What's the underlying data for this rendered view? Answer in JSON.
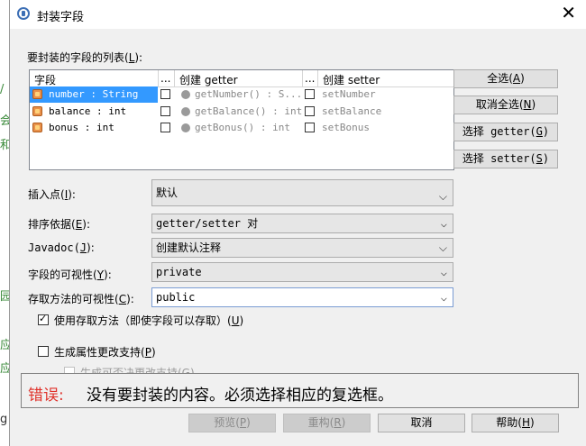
{
  "background": {
    "chars": [
      "/",
      "会",
      "和",
      "园",
      "应",
      "应",
      "g"
    ]
  },
  "titlebar": {
    "title": "封装字段",
    "close_glyph": "✕"
  },
  "fields_list": {
    "label": "要封装的字段的列表(",
    "label_key": "L",
    "label_end": "):",
    "columns": [
      "字段",
      "...",
      "创建 getter",
      "...",
      "创建 setter"
    ],
    "rows": [
      {
        "field": "number : String",
        "getter": "getNumber() : S...",
        "setter": "setNumber",
        "selected": true
      },
      {
        "field": "balance : int",
        "getter": "getBalance() : int",
        "setter": "setBalance",
        "selected": false
      },
      {
        "field": "bonus : int",
        "getter": "getBonus() : int",
        "setter": "setBonus",
        "selected": false
      }
    ]
  },
  "side_buttons": [
    {
      "label": "全选(",
      "key": "A",
      "end": ")"
    },
    {
      "label": "取消全选(",
      "key": "N",
      "end": ")"
    },
    {
      "label": "选择 getter(",
      "key": "G",
      "end": ")"
    },
    {
      "label": "选择 setter(",
      "key": "S",
      "end": ")"
    }
  ],
  "options": {
    "insert_point": {
      "label": "插入点(",
      "key": "I",
      "end": "):",
      "value": "默认"
    },
    "sort_by": {
      "label": "排序依据(",
      "key": "E",
      "end": "):",
      "value": "getter/setter 对"
    },
    "javadoc": {
      "label": "Javadoc(",
      "key": "J",
      "end": "):",
      "value": "创建默认注释"
    },
    "field_visibility": {
      "label": "字段的可视性(",
      "key": "Y",
      "end": "):",
      "value": "private"
    },
    "accessor_visibility": {
      "label": "存取方法的可视性(",
      "key": "C",
      "end": "):",
      "value": "public"
    }
  },
  "checkboxes": {
    "use_accessors": {
      "label": "使用存取方法（即使字段可以存取）(",
      "key": "U",
      "end": ")",
      "checked": true
    },
    "property_change": {
      "label": "生成属性更改支持(",
      "key": "P",
      "end": ")",
      "checked": false
    },
    "veto_change": {
      "label": "生成可否决更改支持(G)",
      "checked": false
    }
  },
  "error": {
    "label": "错误:",
    "message": "没有要封装的内容。必须选择相应的复选框。"
  },
  "footer_buttons": [
    {
      "label": "预览(",
      "key": "P",
      "end": ")",
      "enabled": false
    },
    {
      "label": "重构(",
      "key": "R",
      "end": ")",
      "enabled": false
    },
    {
      "label": "取消",
      "key": "",
      "end": "",
      "enabled": true
    },
    {
      "label": "帮助(",
      "key": "H",
      "end": ")",
      "enabled": true
    }
  ],
  "colors": {
    "selection": "#3399ff",
    "error": "#e0312a"
  }
}
